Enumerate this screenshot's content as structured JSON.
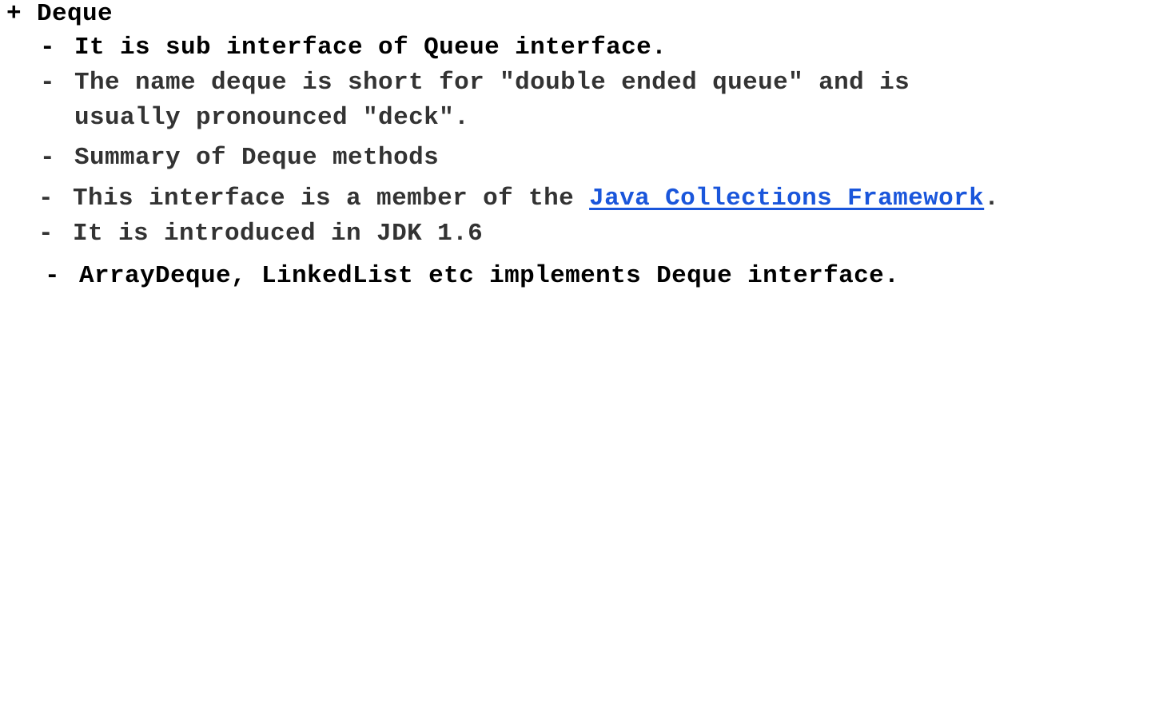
{
  "heading": {
    "marker": "+",
    "title": "Deque"
  },
  "bullets": [
    {
      "dash": "-",
      "lines": [
        "It is sub interface of Queue interface."
      ]
    },
    {
      "dash": "-",
      "lines": [
        "The name deque is short for \"double ended queue\" and is",
        "usually pronounced \"deck\"."
      ]
    },
    {
      "dash": "-",
      "lines": [
        "Summary of Deque methods"
      ]
    },
    {
      "dash": "-",
      "prefix": "This interface is a member of the ",
      "link": "Java Collections Framework",
      "suffix": "."
    },
    {
      "dash": "-",
      "lines": [
        "It is introduced in JDK 1.6"
      ]
    },
    {
      "dash": "-",
      "lines": [
        "ArrayDeque, LinkedList etc implements Deque interface."
      ]
    }
  ],
  "colors": {
    "text": "#000000",
    "muted_text": "#333333",
    "link": "#1a56db",
    "background": "#ffffff"
  }
}
